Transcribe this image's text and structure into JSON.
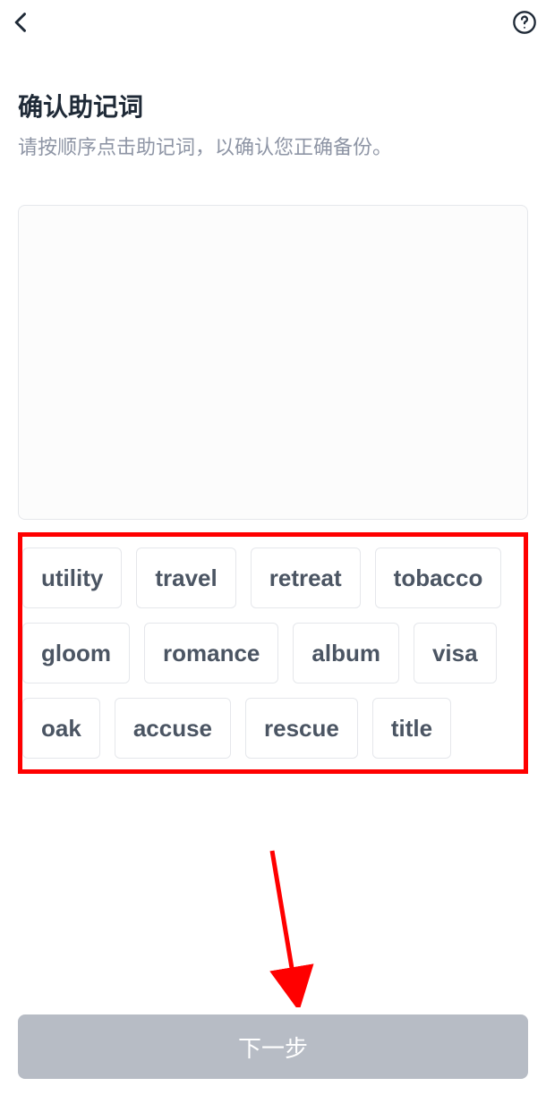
{
  "header": {
    "back_label": "Back",
    "help_label": "Help"
  },
  "page": {
    "title": "确认助记词",
    "subtitle": "请按顺序点击助记词，以确认您正确备份。"
  },
  "words": [
    "utility",
    "travel",
    "retreat",
    "tobacco",
    "gloom",
    "romance",
    "album",
    "visa",
    "oak",
    "accuse",
    "rescue",
    "title"
  ],
  "footer": {
    "next_label": "下一步"
  },
  "annotations": {
    "highlight_color": "#ff0000"
  }
}
